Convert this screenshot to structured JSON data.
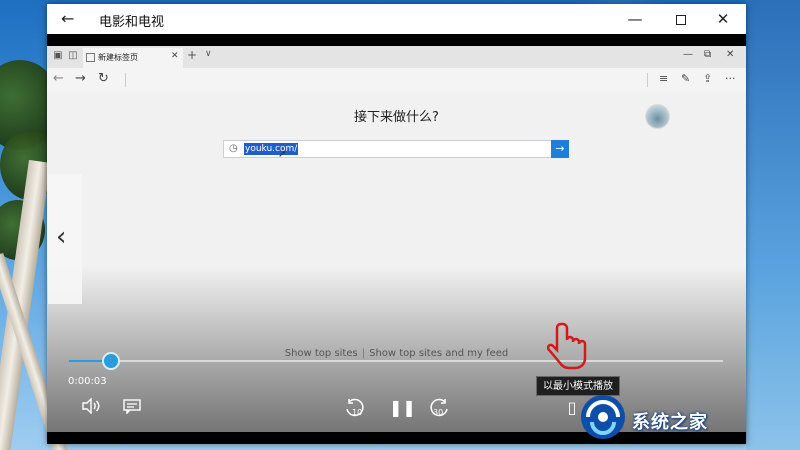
{
  "window": {
    "title": "电影和电视",
    "back_glyph": "←",
    "minimize_glyph": "—",
    "close_glyph": "✕"
  },
  "browser": {
    "tab_label": "新建标签页",
    "tab_close_glyph": "✕",
    "new_tab_glyph": "+",
    "tab_menu_glyph": "∨",
    "window_controls": [
      "—",
      "⧉",
      "✕"
    ],
    "nav": {
      "back": "←",
      "forward": "→",
      "refresh": "↻"
    },
    "toolbar": {
      "hub": "≡",
      "notes": "✎",
      "share": "⇪",
      "more": "···"
    },
    "heading": "接下来做什么?",
    "search": {
      "value": "youku.com/",
      "history_glyph": "◷",
      "go_glyph": "→"
    },
    "top_sites": {
      "option1": "Show top sites",
      "separator": "|",
      "option2": "Show top sites and my feed"
    }
  },
  "player": {
    "prev_glyph": "‹",
    "position": "0:00:03",
    "progress_fraction": 0.064,
    "rewind_seconds": "10",
    "forward_seconds": "30",
    "pause_glyph": "❚❚",
    "volume_glyph": "🔊",
    "mini_glyph": "▯",
    "tooltip": "以最小模式播放",
    "accent_color": "#2a9bdc"
  },
  "watermark": {
    "text": "系统之家"
  }
}
